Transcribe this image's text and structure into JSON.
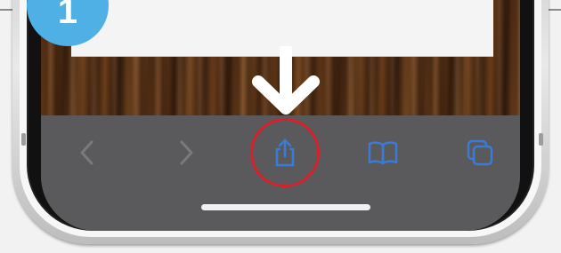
{
  "step_badge": {
    "number": "1"
  },
  "toolbar": {
    "icons": [
      "chevron-left-icon",
      "chevron-right-icon",
      "share-icon",
      "book-icon",
      "tabs-icon"
    ]
  },
  "colors": {
    "toolbar_bg": "#5a5a5c",
    "icon_active": "#3a7bd5",
    "icon_disabled": "#7a7a7c",
    "highlight_ring": "#d8202a",
    "badge": "#4fb0e6"
  }
}
